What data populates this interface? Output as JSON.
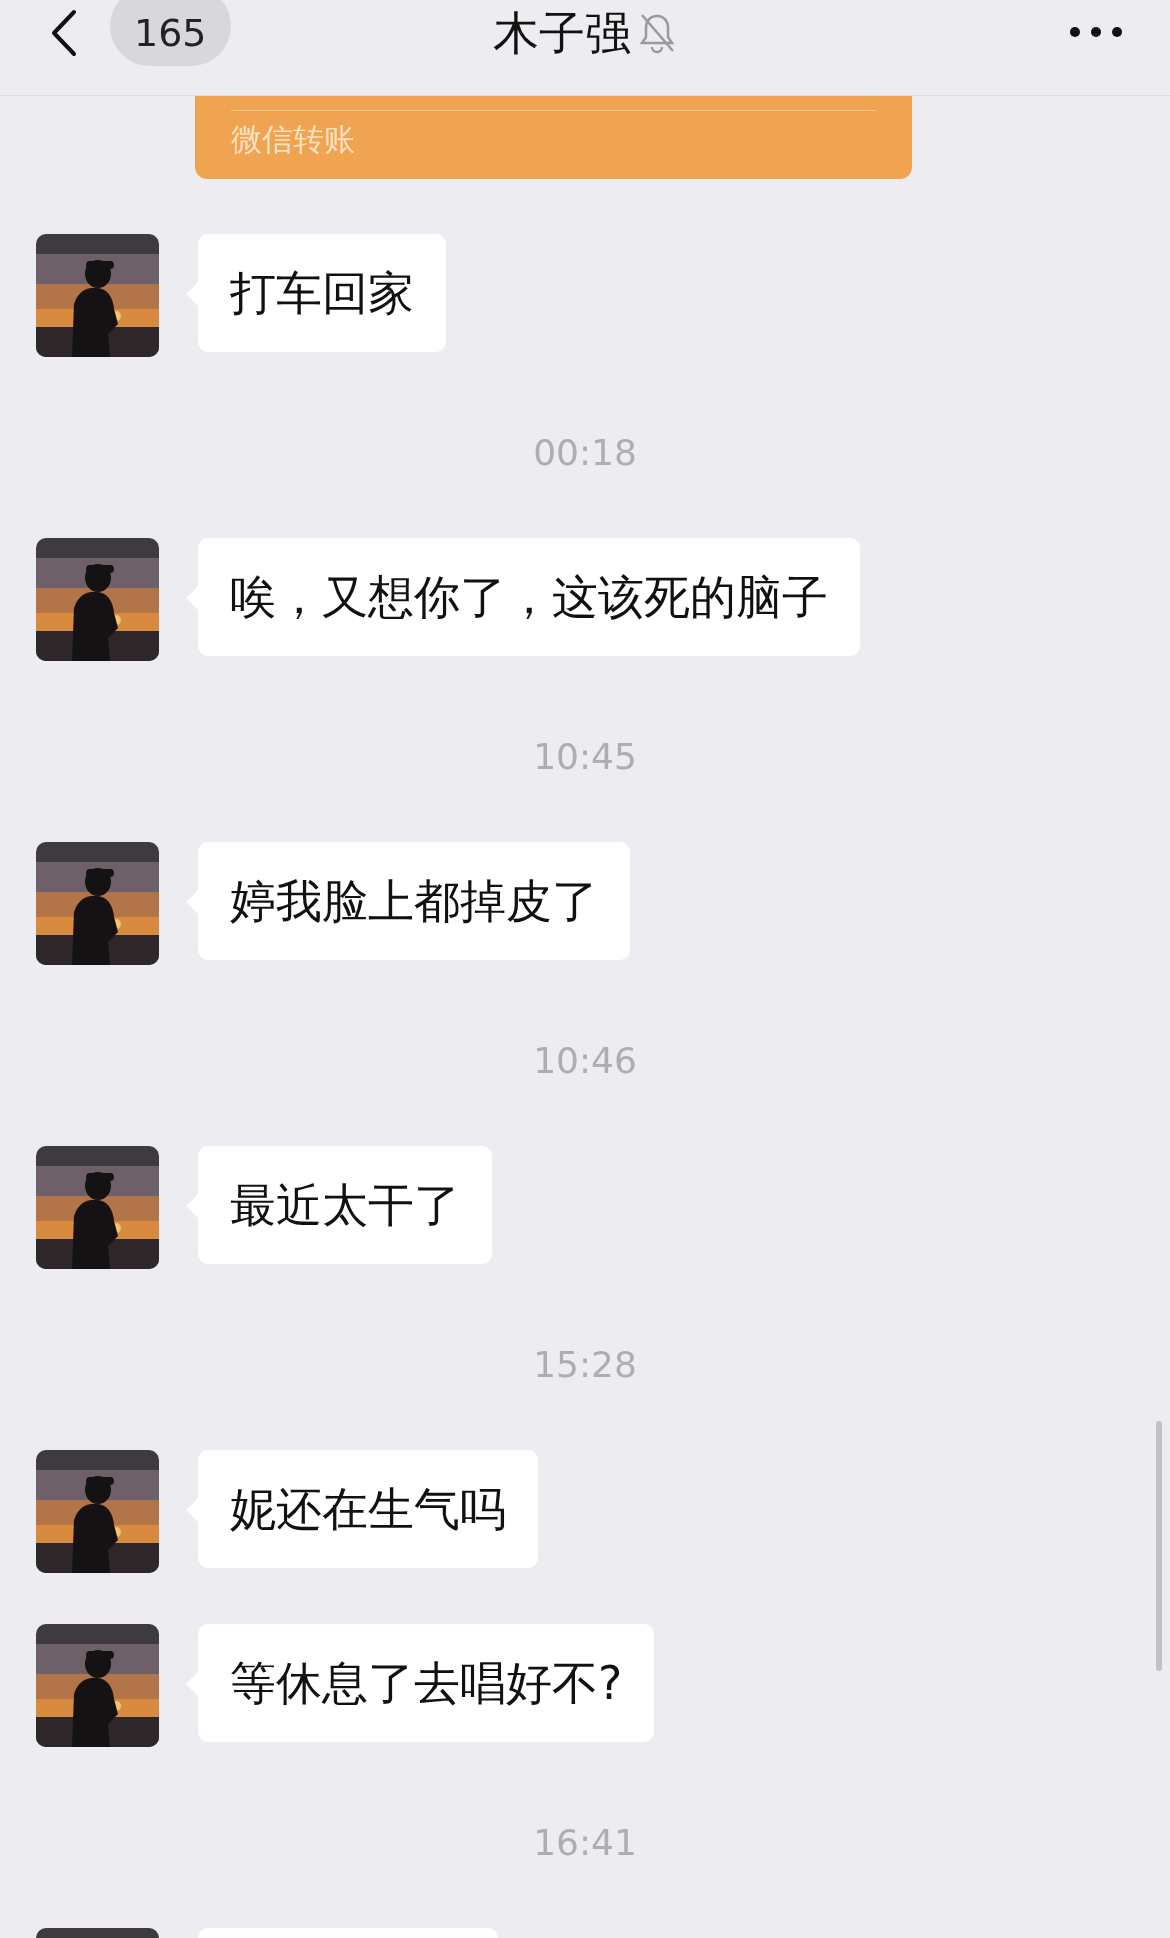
{
  "header": {
    "back_badge": "165",
    "title": "木子强",
    "muted": true
  },
  "transfer_card": {
    "label": "微信转账"
  },
  "items": [
    {
      "kind": "message",
      "text": "打车回家"
    },
    {
      "kind": "time",
      "text": "00:18"
    },
    {
      "kind": "message",
      "text": "唉，又想你了，这该死的脑子"
    },
    {
      "kind": "time",
      "text": "10:45"
    },
    {
      "kind": "message",
      "text": "婷我脸上都掉皮了"
    },
    {
      "kind": "time",
      "text": "10:46"
    },
    {
      "kind": "message",
      "text": "最近太干了"
    },
    {
      "kind": "time",
      "text": "15:28"
    },
    {
      "kind": "message",
      "text": "妮还在生气吗"
    },
    {
      "kind": "message",
      "text": "等休息了去唱好不?"
    },
    {
      "kind": "time",
      "text": "16:41"
    },
    {
      "kind": "partial"
    }
  ]
}
